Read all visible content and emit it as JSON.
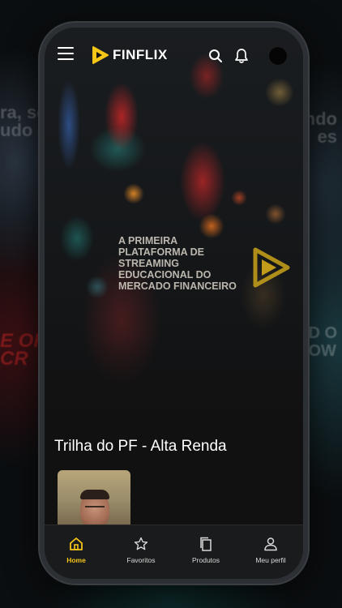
{
  "app": {
    "name": "FINFLIX"
  },
  "hero": {
    "tagline": "A PRIMEIRA PLATAFORMA DE STREAMING EDUCACIONAL DO MERCADO FINANCEIRO"
  },
  "section": {
    "title": "Trilha do PF - Alta Renda"
  },
  "nav": {
    "items": [
      {
        "label": "Home",
        "icon": "home-icon",
        "active": true
      },
      {
        "label": "Favoritos",
        "icon": "star-icon",
        "active": false
      },
      {
        "label": "Produtos",
        "icon": "copy-icon",
        "active": false
      },
      {
        "label": "Meu perfil",
        "icon": "user-icon",
        "active": false
      }
    ]
  },
  "colors": {
    "accent": "#f5c518",
    "background": "#111111",
    "navbar": "#1a1b1c"
  }
}
